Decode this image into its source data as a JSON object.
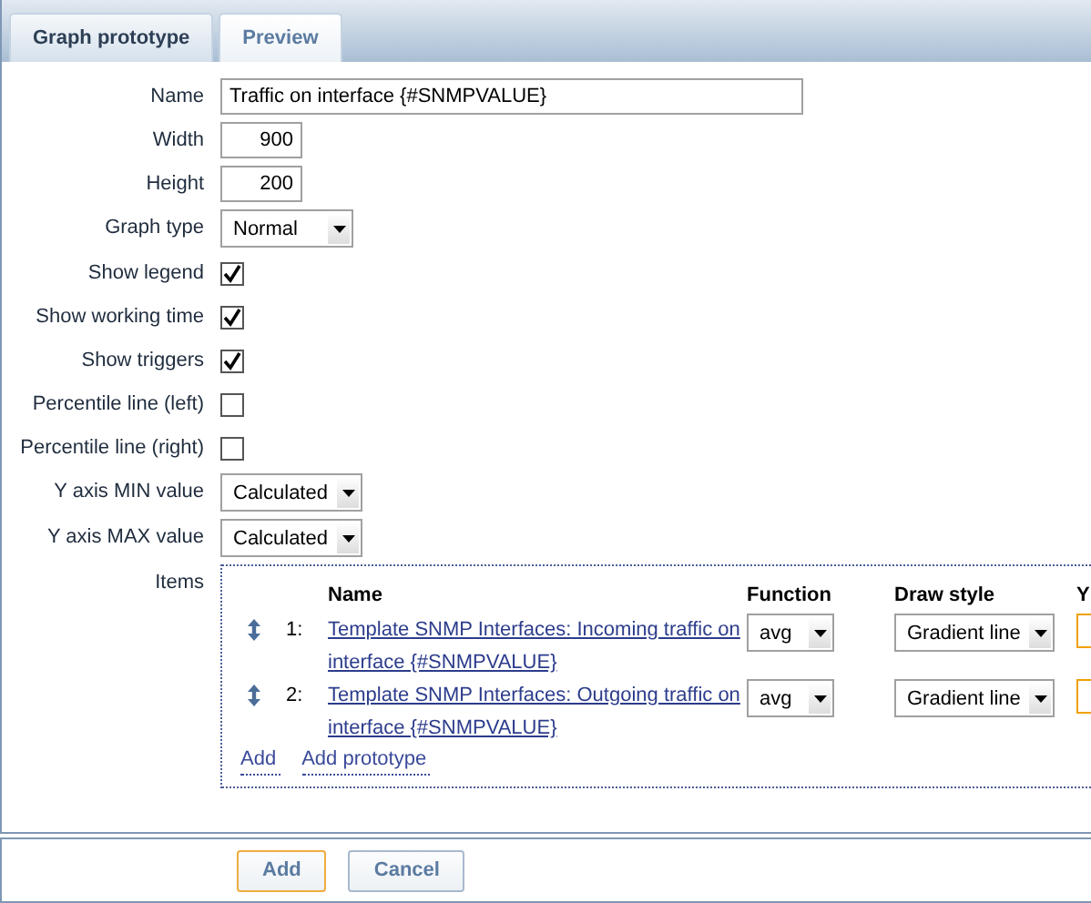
{
  "tabs": [
    {
      "label": "Graph prototype",
      "selected": true
    },
    {
      "label": "Preview",
      "selected": false
    }
  ],
  "fields": [
    {
      "kind": "text",
      "label": "Name",
      "value": "Traffic on interface {#SNMPVALUE}"
    },
    {
      "kind": "number",
      "label": "Width",
      "value": "900"
    },
    {
      "kind": "number",
      "label": "Height",
      "value": "200"
    },
    {
      "kind": "select",
      "label": "Graph type",
      "value": "Normal"
    },
    {
      "kind": "checkbox",
      "label": "Show legend",
      "checked": true
    },
    {
      "kind": "checkbox",
      "label": "Show working time",
      "checked": true
    },
    {
      "kind": "checkbox",
      "label": "Show triggers",
      "checked": true
    },
    {
      "kind": "checkbox",
      "label": "Percentile line (left)",
      "checked": false
    },
    {
      "kind": "checkbox",
      "label": "Percentile line (right)",
      "checked": false
    },
    {
      "kind": "select",
      "label": "Y axis MIN value",
      "value": "Calculated"
    },
    {
      "kind": "select",
      "label": "Y axis MAX value",
      "value": "Calculated"
    }
  ],
  "items": {
    "label": "Items",
    "columns": [
      "Name",
      "Function",
      "Draw style",
      "Y"
    ],
    "rows": [
      {
        "number": "1:",
        "name": "Template SNMP Interfaces: Incoming traffic on interface {#SNMPVALUE}",
        "function": "avg",
        "draw_style": "Gradient line"
      },
      {
        "number": "2:",
        "name": "Template SNMP Interfaces: Outgoing traffic on interface {#SNMPVALUE}",
        "function": "avg",
        "draw_style": "Gradient line"
      }
    ],
    "links": [
      "Add",
      "Add prototype"
    ]
  },
  "buttons": [
    {
      "label": "Add",
      "focused": true
    },
    {
      "label": "Cancel",
      "focused": false
    }
  ]
}
